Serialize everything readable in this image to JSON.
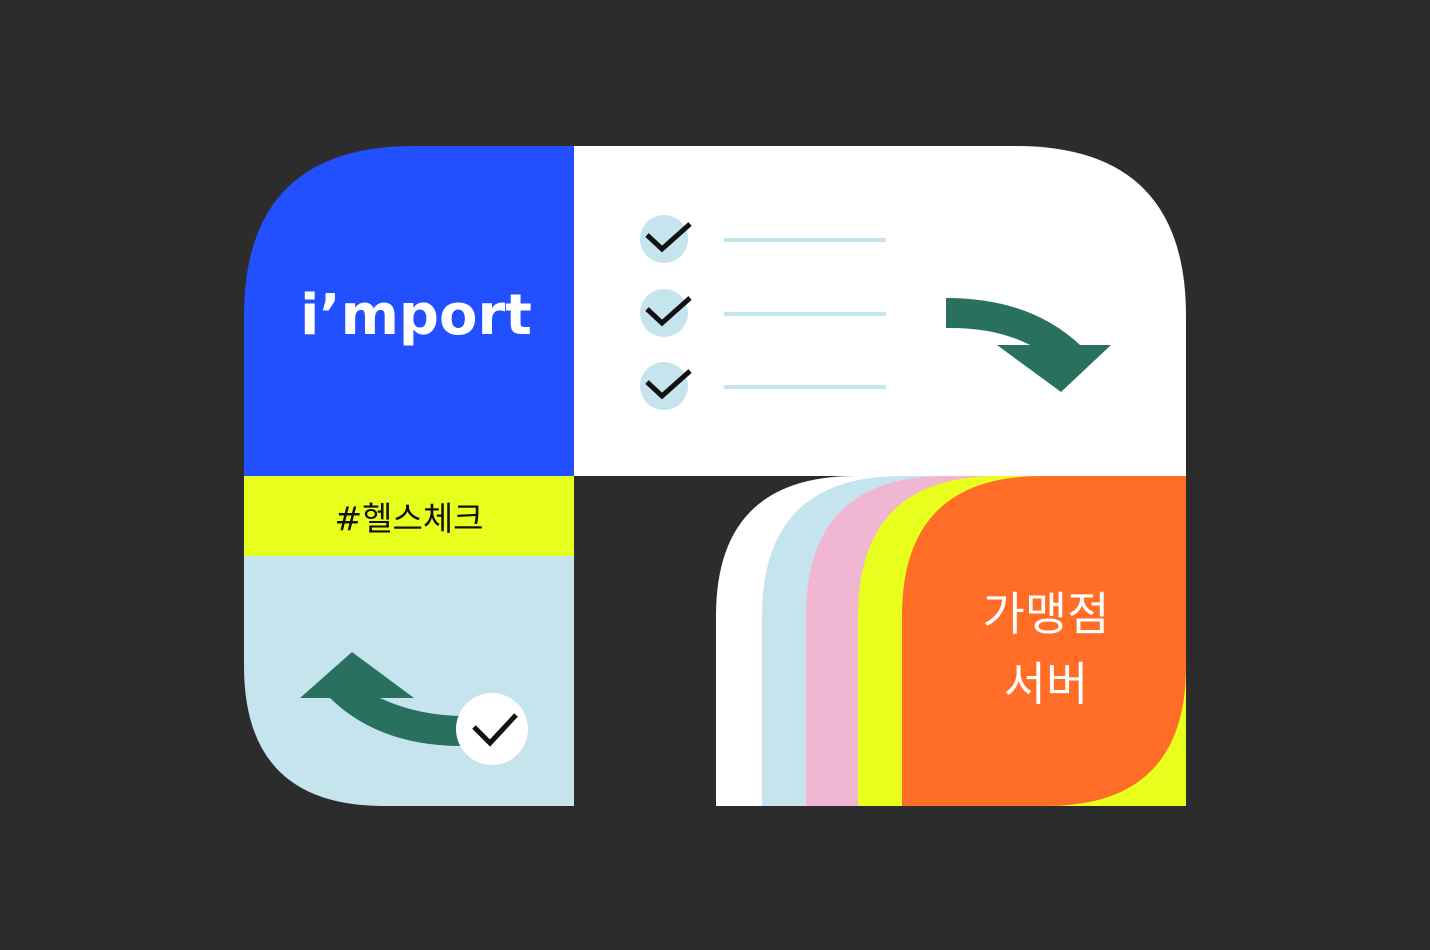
{
  "brand": {
    "logo_text": "i’mport"
  },
  "tag": {
    "label": "#헬스체크"
  },
  "server": {
    "line1": "가맹점",
    "line2": "서버"
  },
  "checklist": {
    "items": [
      {
        "checked": true
      },
      {
        "checked": true
      },
      {
        "checked": true
      }
    ]
  },
  "colors": {
    "background": "#2c2c2c",
    "brand_blue": "#2250ff",
    "white": "#ffffff",
    "light_blue": "#c6e4ee",
    "lime": "#e8ff1d",
    "pink": "#f1b7d2",
    "orange": "#ff6d27",
    "green_arrow": "#2a705e",
    "check_circle": "#c6e4ee",
    "line": "#c6e4ee"
  },
  "icons": {
    "check": "check-icon",
    "arrow_down_right": "curved-arrow-down-right-icon",
    "arrow_left": "curved-arrow-left-icon"
  }
}
